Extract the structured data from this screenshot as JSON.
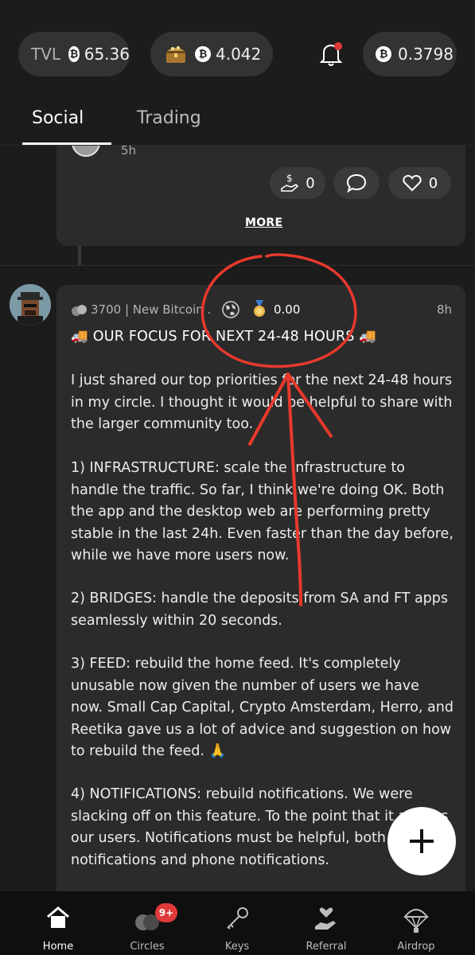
{
  "header": {
    "tvl_label": "TVL",
    "tvl_value": "65.36",
    "chest_value": "4.042",
    "balance_value": "0.3798",
    "coin_glyph": "₿"
  },
  "tabs": [
    {
      "label": "Social",
      "active": true
    },
    {
      "label": "Trading",
      "active": false
    }
  ],
  "prev_post": {
    "time": "5h",
    "tip_count": "0",
    "like_count": "0",
    "more_label": "MORE"
  },
  "post": {
    "circle_info": "3700 | New Bitcoin ...",
    "tip_amount": "0.00",
    "time": "8h",
    "title": "🚚 OUR FOCUS FOR NEXT 24-48 HOURS 🚚",
    "paragraphs": [
      "I just shared our top priorities for the next 24-48 hours in my circle. I thought it would be helpful to share with the larger community too.",
      "1) INFRASTRUCTURE: scale the infrastructure to handle the traffic. So far, I think we're doing OK. Both the app and the desktop web are performing pretty stable in the last 24h. Even faster than the day before, while we have more users now.",
      "2) BRIDGES: handle the deposits from SA and FT apps seamlessly within 20 seconds.",
      "3) FEED: rebuild the home feed. It's completely unusable now given the number of users we have now. Small Cap Capital, Crypto Amsterdam, Herro, and Reetika gave us a lot of advice and suggestion on how to rebuild the feed. 🙏",
      "4) NOTIFICATIONS: rebuild notifications. We were slacking off on this feature.  To the point that it annoys our users.  Notifications must be helpful, both in app notifications and phone notifications."
    ]
  },
  "bottom_nav": [
    {
      "label": "Home",
      "icon": "home-icon",
      "active": true
    },
    {
      "label": "Circles",
      "icon": "circles-icon",
      "badge": "9+"
    },
    {
      "label": "Keys",
      "icon": "keys-icon"
    },
    {
      "label": "Referral",
      "icon": "referral-icon"
    },
    {
      "label": "Airdrop",
      "icon": "airdrop-icon"
    }
  ],
  "colors": {
    "background": "#1c1c1c",
    "card": "#2b2b2b",
    "annotation_red": "#e8392c",
    "badge_red": "#e0393b"
  }
}
